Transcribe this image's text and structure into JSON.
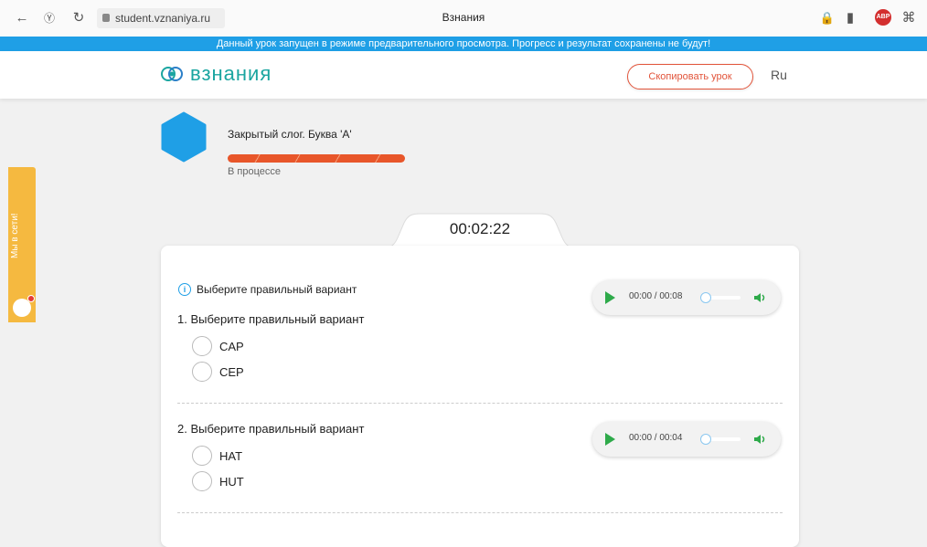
{
  "browser": {
    "url": "student.vznaniya.ru",
    "tab_title": "Взнания"
  },
  "banner": {
    "text": "Данный урок запущен в режиме предварительного просмотра. Прогресс и результат сохранены не будут!"
  },
  "header": {
    "logo_text": "взнания",
    "copy_button": "Скопировать урок",
    "language": "Ru"
  },
  "lesson": {
    "title": "Закрытый слог. Буква 'A'",
    "progress_percent": 100,
    "status": "В процессе"
  },
  "side_tab": {
    "label": "Мы в сети!"
  },
  "timer": "00:02:22",
  "instruction": "Выберите правильный вариант",
  "questions": [
    {
      "title": "1. Выберите правильный вариант",
      "options": [
        "CAP",
        "CEP"
      ],
      "audio_time": "00:00 / 00:08"
    },
    {
      "title": "2. Выберите правильный вариант",
      "options": [
        "HAT",
        "HUT"
      ],
      "audio_time": "00:00 / 00:04"
    }
  ],
  "colors": {
    "banner": "#1f9fe6",
    "brand": "#1aa5a0",
    "accent": "#e2543a",
    "progress": "#e8562a",
    "side_tab": "#f5b940"
  }
}
